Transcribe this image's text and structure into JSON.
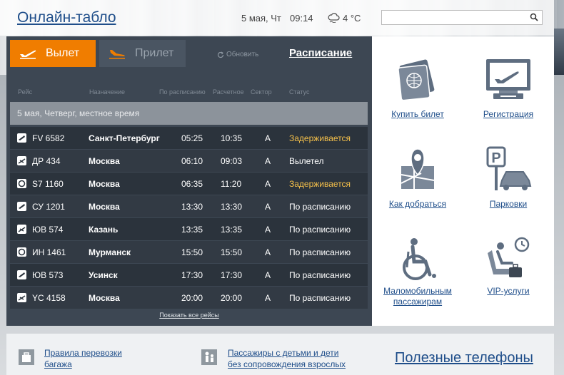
{
  "header": {
    "title": "Онлайн-табло",
    "date": "5 мая, Чт",
    "time": "09:14",
    "temperature": "4 °C",
    "search_placeholder": ""
  },
  "board": {
    "tabs": {
      "departure": "Вылет",
      "arrival": "Прилет"
    },
    "refresh_label": "Обновить",
    "schedule_label": "Расписание",
    "columns": {
      "flight": "Рейс",
      "destination": "Назначение",
      "scheduled": "По расписанию",
      "estimated": "Расчетное",
      "sector": "Сектор",
      "status": "Статус"
    },
    "date_row": "5 мая, Четверг, местное время",
    "flights": [
      {
        "num": "FV 6582",
        "dest": "Санкт-Петербург",
        "sched": "05:25",
        "est": "10:35",
        "sector": "A",
        "status": "Задерживается",
        "delayed": true
      },
      {
        "num": "ДР 434",
        "dest": "Москва",
        "sched": "06:10",
        "est": "09:03",
        "sector": "A",
        "status": "Вылетел",
        "delayed": false
      },
      {
        "num": "S7 1160",
        "dest": "Москва",
        "sched": "06:35",
        "est": "11:20",
        "sector": "A",
        "status": "Задерживается",
        "delayed": true
      },
      {
        "num": "СУ 1201",
        "dest": "Москва",
        "sched": "13:30",
        "est": "13:30",
        "sector": "A",
        "status": "По расписанию",
        "delayed": false
      },
      {
        "num": "ЮВ 574",
        "dest": "Казань",
        "sched": "13:35",
        "est": "13:35",
        "sector": "A",
        "status": "По расписанию",
        "delayed": false
      },
      {
        "num": "ИН 1461",
        "dest": "Мурманск",
        "sched": "15:50",
        "est": "15:50",
        "sector": "A",
        "status": "По расписанию",
        "delayed": false
      },
      {
        "num": "ЮВ 573",
        "dest": "Усинск",
        "sched": "17:30",
        "est": "17:30",
        "sector": "A",
        "status": "По расписанию",
        "delayed": false
      },
      {
        "num": "YC 4158",
        "dest": "Москва",
        "sched": "20:00",
        "est": "20:00",
        "sector": "A",
        "status": "По расписанию",
        "delayed": false
      }
    ],
    "show_all": "Показать все рейсы"
  },
  "services": {
    "buy_ticket": "Купить билет",
    "registration": "Регистрация",
    "directions": "Как добраться",
    "parking": "Парковки",
    "reduced_mobility_1": "Маломобильным",
    "reduced_mobility_2": "пассажирам",
    "vip": "VIP-услуги"
  },
  "bottom": {
    "baggage_1": "Правила перевозки",
    "baggage_2": "багажа",
    "children_1": "Пассажиры с детьми и дети",
    "children_2": "без сопровождения взрослых",
    "phones": "Полезные телефоны"
  },
  "colors": {
    "accent": "#f07d00",
    "link": "#1f4e8a",
    "board_bg": "#3d4753",
    "delay": "#f5c04a"
  }
}
